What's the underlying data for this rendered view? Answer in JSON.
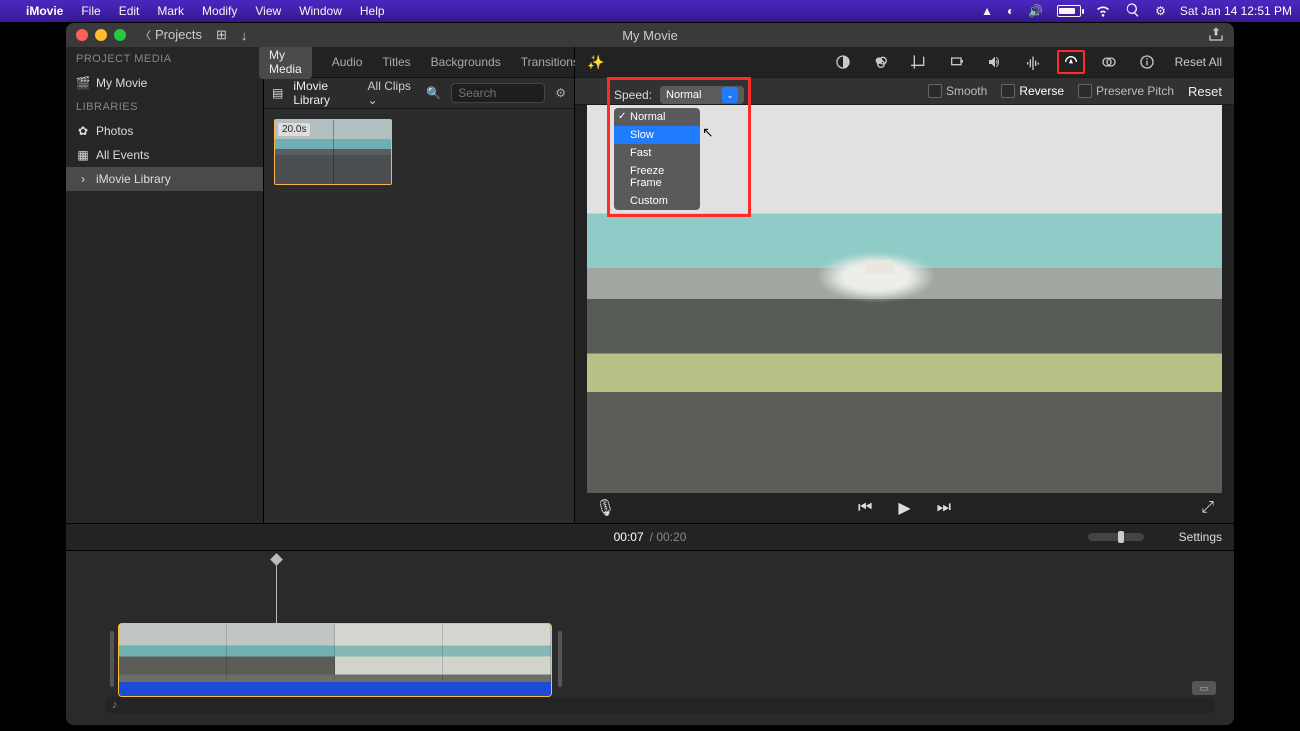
{
  "menubar": {
    "app": "iMovie",
    "items": [
      "File",
      "Edit",
      "Mark",
      "Modify",
      "View",
      "Window",
      "Help"
    ],
    "clock": "Sat Jan 14  12:51 PM"
  },
  "window": {
    "title": "My Movie",
    "projects_label": "Projects"
  },
  "sidebar": {
    "section1": "PROJECT MEDIA",
    "movie": "My Movie",
    "section2": "LIBRARIES",
    "photos": "Photos",
    "all_events": "All Events",
    "library": "iMovie Library"
  },
  "tabs": {
    "my_media": "My Media",
    "audio": "Audio",
    "titles": "Titles",
    "backgrounds": "Backgrounds",
    "transitions": "Transitions"
  },
  "library": {
    "title": "iMovie Library",
    "filter": "All Clips",
    "search_placeholder": "Search",
    "clip_duration": "20.0s"
  },
  "viewer_tools": {
    "reset_all": "Reset All"
  },
  "speed_panel": {
    "speed_label": "Speed:",
    "selected": "Normal",
    "options": {
      "normal": "Normal",
      "slow": "Slow",
      "fast": "Fast",
      "freeze": "Freeze Frame",
      "custom": "Custom"
    },
    "smooth": "Smooth",
    "reverse": "Reverse",
    "preserve": "Preserve Pitch",
    "reset": "Reset"
  },
  "time": {
    "current": "00:07",
    "sep": "/",
    "duration": "00:20",
    "settings": "Settings"
  }
}
